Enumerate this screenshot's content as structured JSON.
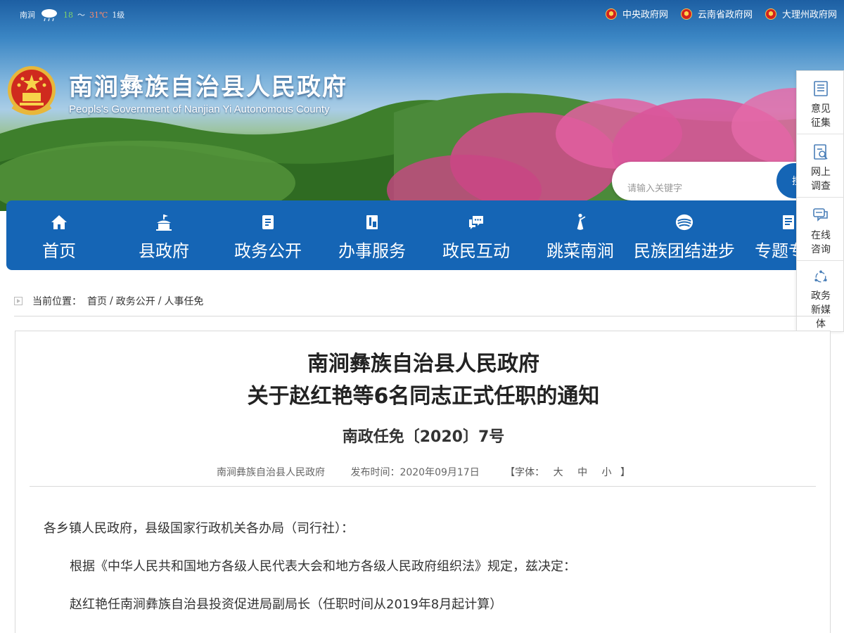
{
  "topbar": {
    "weather_city": "南涧",
    "weather_temp_low": "18",
    "weather_sep": "～",
    "weather_temp_high": "31℃",
    "weather_wind": "1级",
    "links": [
      {
        "label": "中央政府网"
      },
      {
        "label": "云南省政府网"
      },
      {
        "label": "大理州政府网"
      }
    ]
  },
  "header": {
    "title": "南涧彝族自治县人民政府",
    "subtitle": "Peopls's Government of Nanjian Yi Autonomous County"
  },
  "search": {
    "placeholder": "请输入关键字",
    "button_label": "搜"
  },
  "nav": {
    "items": [
      {
        "label": "首页",
        "icon": "home-icon"
      },
      {
        "label": "县政府",
        "icon": "government-building-icon"
      },
      {
        "label": "政务公开",
        "icon": "document-icon"
      },
      {
        "label": "办事服务",
        "icon": "service-icon"
      },
      {
        "label": "政民互动",
        "icon": "chat-icon"
      },
      {
        "label": "跳菜南涧",
        "icon": "dancer-icon"
      },
      {
        "label": "民族团结进步",
        "icon": "unity-icon"
      },
      {
        "label": "专题专栏",
        "icon": "topic-icon"
      }
    ]
  },
  "float_panel": {
    "items": [
      {
        "label": "意见征集",
        "icon": "feedback-icon"
      },
      {
        "label": "网上调查",
        "icon": "survey-icon"
      },
      {
        "label": "在线咨询",
        "icon": "consult-icon"
      },
      {
        "label": "政务新媒体",
        "icon": "new-media-icon"
      }
    ]
  },
  "breadcrumb": {
    "prefix": "当前位置：",
    "items": [
      "首页",
      "政务公开",
      "人事任免"
    ],
    "separator": "/"
  },
  "article": {
    "title_line1": "南涧彝族自治县人民政府",
    "title_line2": "关于赵红艳等6名同志正式任职的通知",
    "doc_number": "南政任免〔2020〕7号",
    "source": "南涧彝族自治县人民政府",
    "publish_label": "发布时间：2020年09月17日",
    "font_size_prefix": "【字体：",
    "font_size_large": "大",
    "font_size_medium": "中",
    "font_size_small": "小",
    "font_size_suffix": "】",
    "paragraphs": [
      "各乡镇人民政府，县级国家行政机关各办局（司行社）：",
      "根据《中华人民共和国地方各级人民代表大会和地方各级人民政府组织法》规定，兹决定：",
      "赵红艳任南涧彝族自治县投资促进局副局长（任职时间从2019年8月起计算）"
    ]
  },
  "colors": {
    "nav_blue": "#1565b5",
    "border_gray": "#d9d9d9"
  }
}
